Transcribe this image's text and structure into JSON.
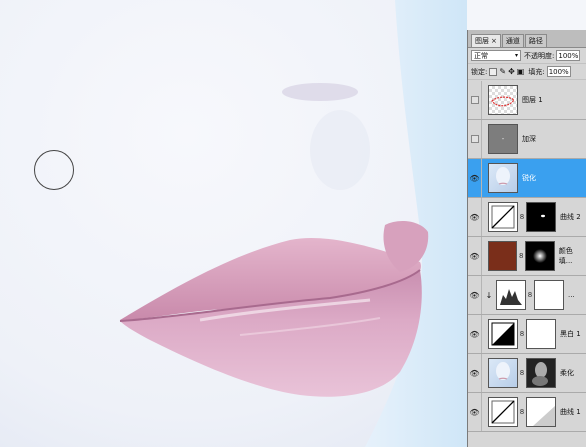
{
  "panel": {
    "tabs": [
      {
        "label": "图层",
        "close": "×"
      },
      {
        "label": "通道"
      },
      {
        "label": "路径"
      }
    ],
    "blend_mode": "正常",
    "opacity_label": "不透明度:",
    "opacity_value": "100%",
    "lock_label": "锁定:",
    "fill_label": "填充:",
    "fill_value": "100%"
  },
  "layers": [
    {
      "name": "图层 1",
      "visible": false
    },
    {
      "name": "加深",
      "visible": false,
      "extra": "-"
    },
    {
      "name": "锐化",
      "visible": true,
      "selected": true
    },
    {
      "name": "曲线 2",
      "visible": true
    },
    {
      "name": "颜色填...",
      "visible": true
    },
    {
      "name": "...",
      "visible": true,
      "clip": "↓"
    },
    {
      "name": "黑白 1",
      "visible": true
    },
    {
      "name": "柔化",
      "visible": true
    },
    {
      "name": "曲线 1",
      "visible": true
    }
  ],
  "icons": {
    "eye": "eye-icon",
    "link": "chain-link-icon",
    "clip": "clip-arrow-icon"
  },
  "colors": {
    "selected": "#3aa0ef",
    "fill_brown": "#7a2e1a"
  }
}
